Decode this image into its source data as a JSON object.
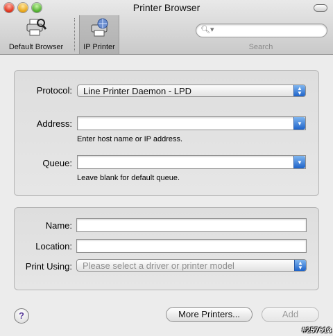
{
  "window": {
    "title": "Printer Browser"
  },
  "toolbar": {
    "tools": [
      {
        "label": "Default Browser",
        "icon": "printer-search-icon"
      },
      {
        "label": "IP Printer",
        "icon": "printer-globe-icon"
      }
    ],
    "search": {
      "placeholder": "",
      "label": "Search"
    }
  },
  "ip_settings": {
    "protocol": {
      "label": "Protocol:",
      "value": "Line Printer Daemon - LPD"
    },
    "address": {
      "label": "Address:",
      "value": "",
      "hint": "Enter host name or IP address."
    },
    "queue": {
      "label": "Queue:",
      "value": "",
      "hint": "Leave blank for default queue."
    }
  },
  "printer_info": {
    "name": {
      "label": "Name:",
      "value": ""
    },
    "location": {
      "label": "Location:",
      "value": ""
    },
    "print_using": {
      "label": "Print Using:",
      "value": "Please select a driver or printer model"
    }
  },
  "buttons": {
    "help": "?",
    "more_printers": "More Printers...",
    "add": "Add"
  },
  "watermark": "#257613"
}
